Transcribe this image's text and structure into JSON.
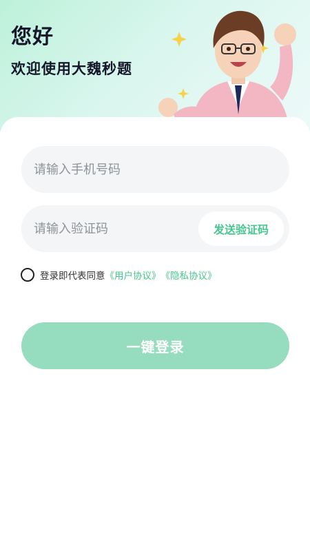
{
  "header": {
    "greeting": "您好",
    "subtitle": "欢迎使用大魏秒题"
  },
  "form": {
    "phone_placeholder": "请输入手机号码",
    "code_placeholder": "请输入验证码",
    "send_code_label": "发送验证码"
  },
  "agreement": {
    "prefix": "登录即代表同意",
    "user_agreement": "《用户协议》",
    "privacy_policy": "《隐私协议》",
    "checked": false
  },
  "login_button_label": "一键登录",
  "colors": {
    "accent": "#48c692",
    "button_disabled": "#96dcbe",
    "field_bg": "#f3f5f7"
  }
}
